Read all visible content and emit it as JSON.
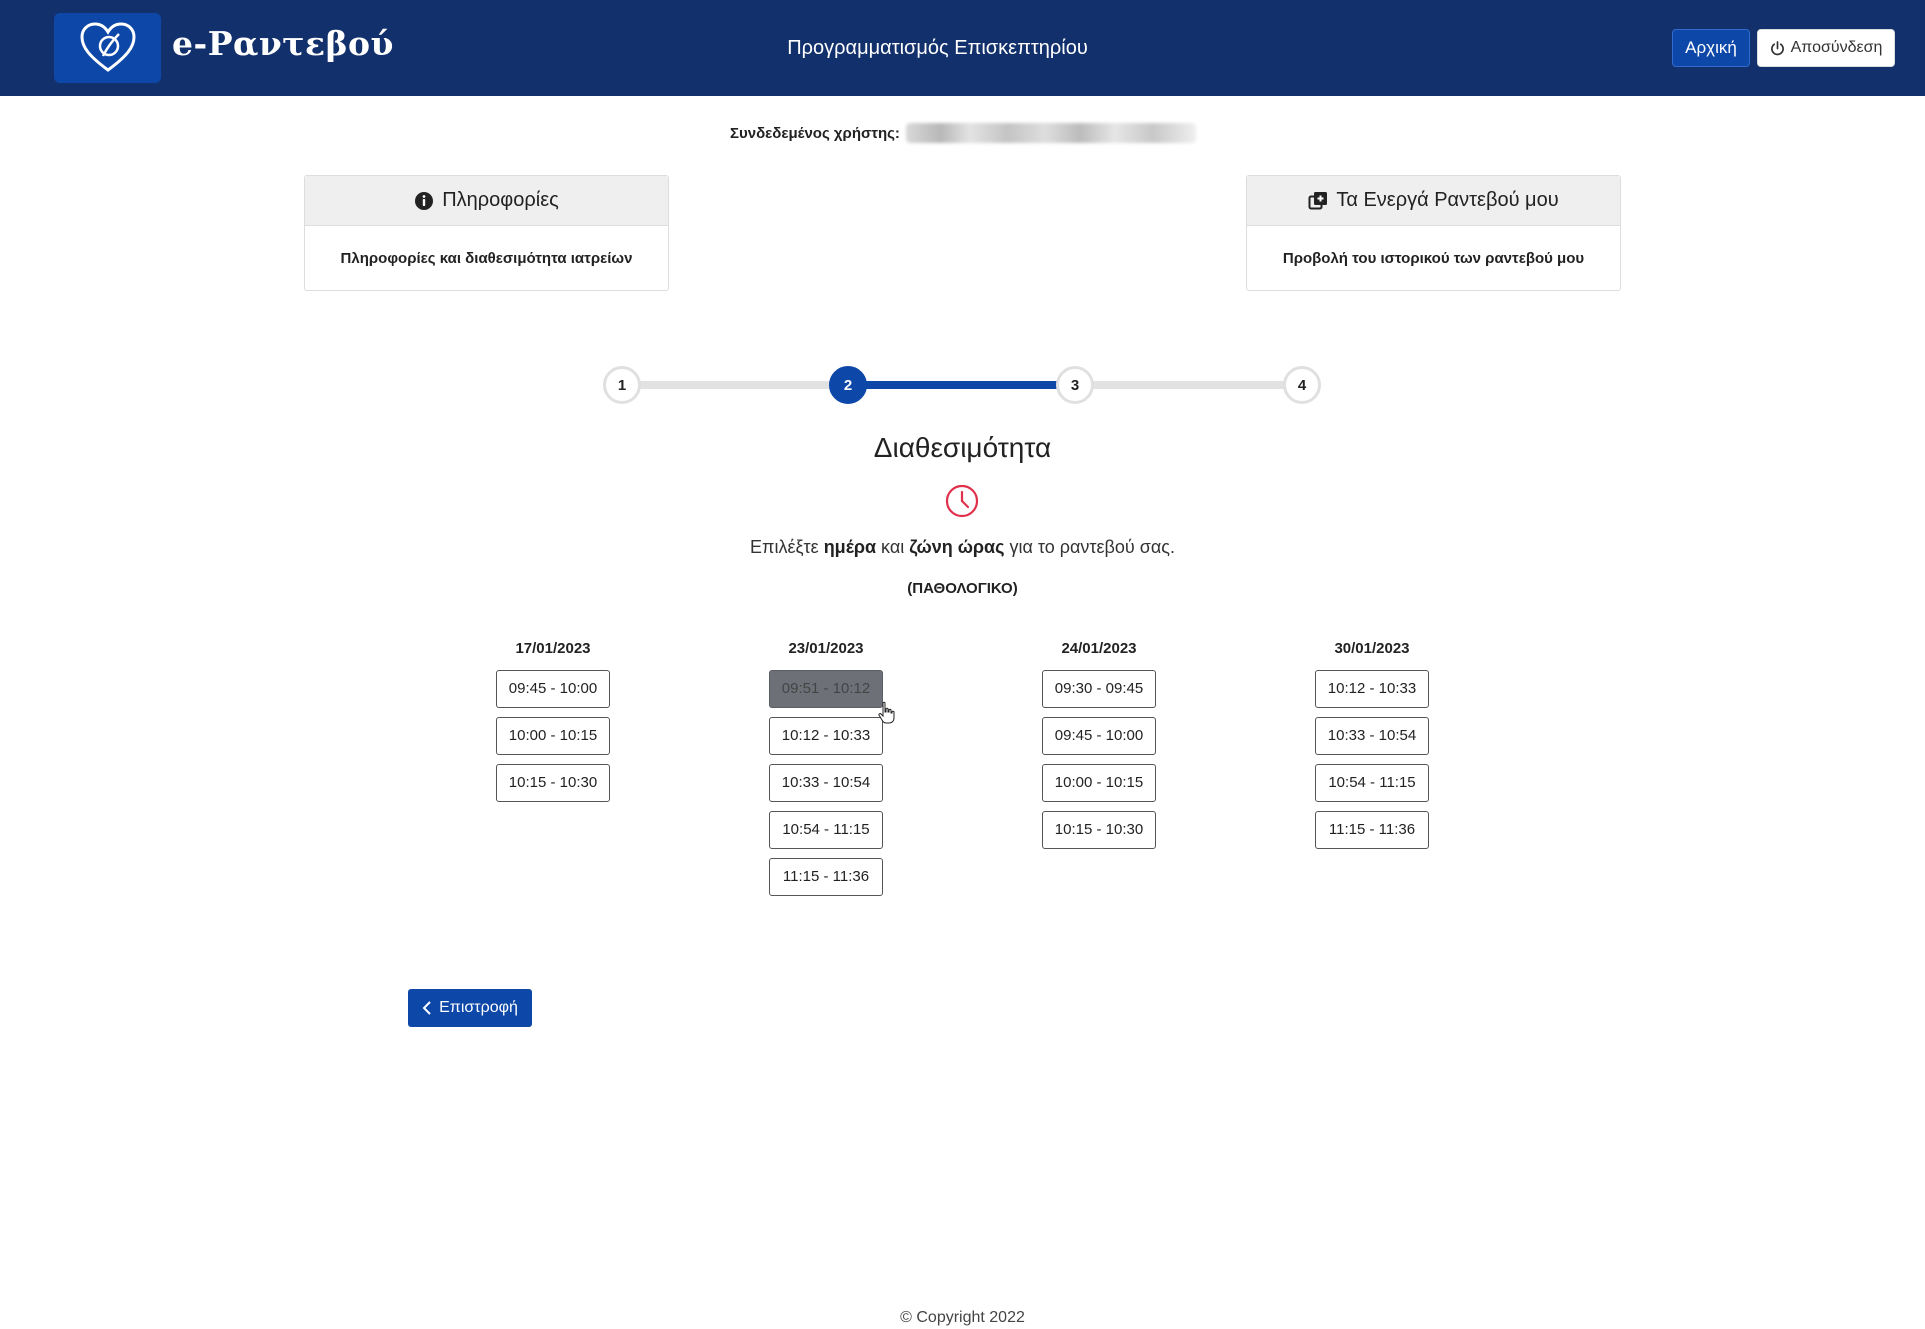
{
  "header": {
    "logo_text": "e-Ραντεβού",
    "title": "Προγραμματισμός Επισκεπτηρίου",
    "home_label": "Αρχική",
    "logout_label": "Αποσύνδεση",
    "background_color": "#12306b",
    "accent_color": "#0d47a8"
  },
  "user": {
    "label": "Συνδεδεμένος χρήστης:"
  },
  "cards": {
    "info": {
      "icon": "info-circle-icon",
      "title": "Πληροφορίες",
      "body": "Πληροφορίες και διαθεσιμότητα ιατρείων"
    },
    "appointments": {
      "icon": "add-copy-icon",
      "title": "Τα Ενεργά Ραντεβού μου",
      "body": "Προβολή του ιστορικού των ραντεβού μου"
    }
  },
  "stepper": {
    "steps": [
      "1",
      "2",
      "3",
      "4"
    ],
    "active_step": 2
  },
  "availability": {
    "title": "Διαθεσιμότητα",
    "icon": "clock-icon",
    "icon_color": "#e0314b",
    "instruction": {
      "part1": "Επιλέξτε ",
      "bold1": "ημέρα",
      "part2": " και ",
      "bold2": "ζώνη ώρας",
      "part3": " για το ραντεβού σας."
    },
    "specialty": "(ΠΑΘΟΛΟΓΙΚΟ)",
    "days": [
      {
        "date": "17/01/2023",
        "slots": [
          "09:45 - 10:00",
          "10:00 - 10:15",
          "10:15 - 10:30"
        ]
      },
      {
        "date": "23/01/2023",
        "slots": [
          "09:51 - 10:12",
          "10:12 - 10:33",
          "10:33 - 10:54",
          "10:54 - 11:15",
          "11:15 - 11:36"
        ]
      },
      {
        "date": "24/01/2023",
        "slots": [
          "09:30 - 09:45",
          "09:45 - 10:00",
          "10:00 - 10:15",
          "10:15 - 10:30"
        ]
      },
      {
        "date": "30/01/2023",
        "slots": [
          "10:12 - 10:33",
          "10:33 - 10:54",
          "10:54 - 11:15",
          "11:15 - 11:36"
        ]
      }
    ]
  },
  "back_label": "Επιστροφή",
  "footer": "© Copyright 2022"
}
